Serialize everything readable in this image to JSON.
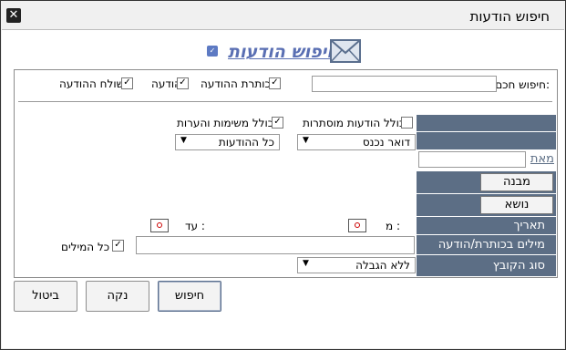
{
  "window": {
    "title": "חיפוש הודעות",
    "close_glyph": "✕"
  },
  "heading": {
    "text": "חיפוש הודעות",
    "dropdown_glyph": "✓",
    "icon": "envelope-icon",
    "color": "#5a6fb3"
  },
  "smart_search": {
    "label": "חיפוש חכם:",
    "value": "",
    "options": [
      {
        "label": "כותרת ההודעה",
        "checked": true
      },
      {
        "label": "הודעה",
        "checked": true
      },
      {
        "label": "שולח ההודעה",
        "checked": true
      }
    ]
  },
  "filters": {
    "include_hidden": {
      "label": "כולל הודעות מוסתרות",
      "checked": false
    },
    "include_tasks": {
      "label": "כולל משימות והערות",
      "checked": true
    },
    "folder": {
      "value": "דואר נכנס"
    },
    "message_filter": {
      "value": "כל ההודעות"
    }
  },
  "side": {
    "from_label": "מאת",
    "from_value": "",
    "structure_button": "מבנה",
    "subject_button": "נושא",
    "date_label": "תאריך",
    "words_label": "מילים בכותרת/הודעה",
    "file_type_label": "סוג הקובץ",
    "color": "#5c6e85"
  },
  "date": {
    "from_label": "מ :",
    "to_label": "עד :"
  },
  "words": {
    "value": "",
    "all_words": {
      "label": "כל המילים",
      "checked": true
    }
  },
  "file_type": {
    "value": "ללא הגבלה"
  },
  "buttons": {
    "search": "חיפוש",
    "clear": "נקה",
    "cancel": "ביטול"
  }
}
